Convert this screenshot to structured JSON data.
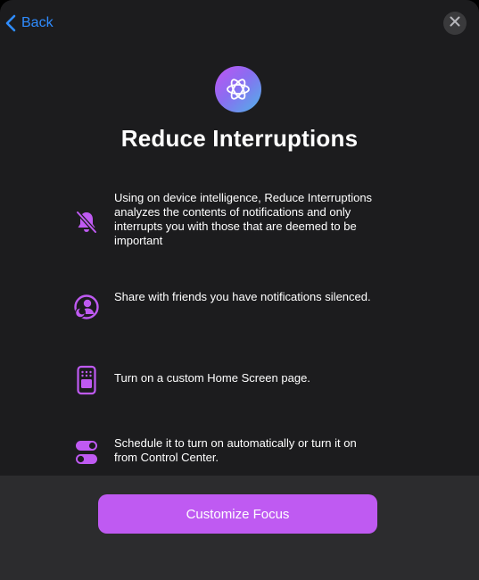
{
  "nav": {
    "back_label": "Back",
    "back_icon": "chevron-left-icon",
    "close_icon": "xmark-icon"
  },
  "hero": {
    "icon": "focus-atom-icon",
    "title": "Reduce Interruptions"
  },
  "features": [
    {
      "icon": "bell-slash-icon",
      "text": "Using on device intelligence, Reduce Interruptions analyzes the contents of notifications and only interrupts you with those that are deemed to be important"
    },
    {
      "icon": "person-moon-icon",
      "text": "Share with friends you have notifications silenced."
    },
    {
      "icon": "home-screen-page-icon",
      "text": "Turn on a custom Home Screen page."
    },
    {
      "icon": "toggle-switches-icon",
      "text": "Schedule it to turn on automatically or turn it on from Control Center."
    }
  ],
  "footer": {
    "cta_label": "Customize Focus"
  },
  "colors": {
    "background": "#1c1c1e",
    "footer": "#2c2c2e",
    "accent": "#bf5af2",
    "link": "#2f8cff",
    "text": "#ffffff"
  }
}
